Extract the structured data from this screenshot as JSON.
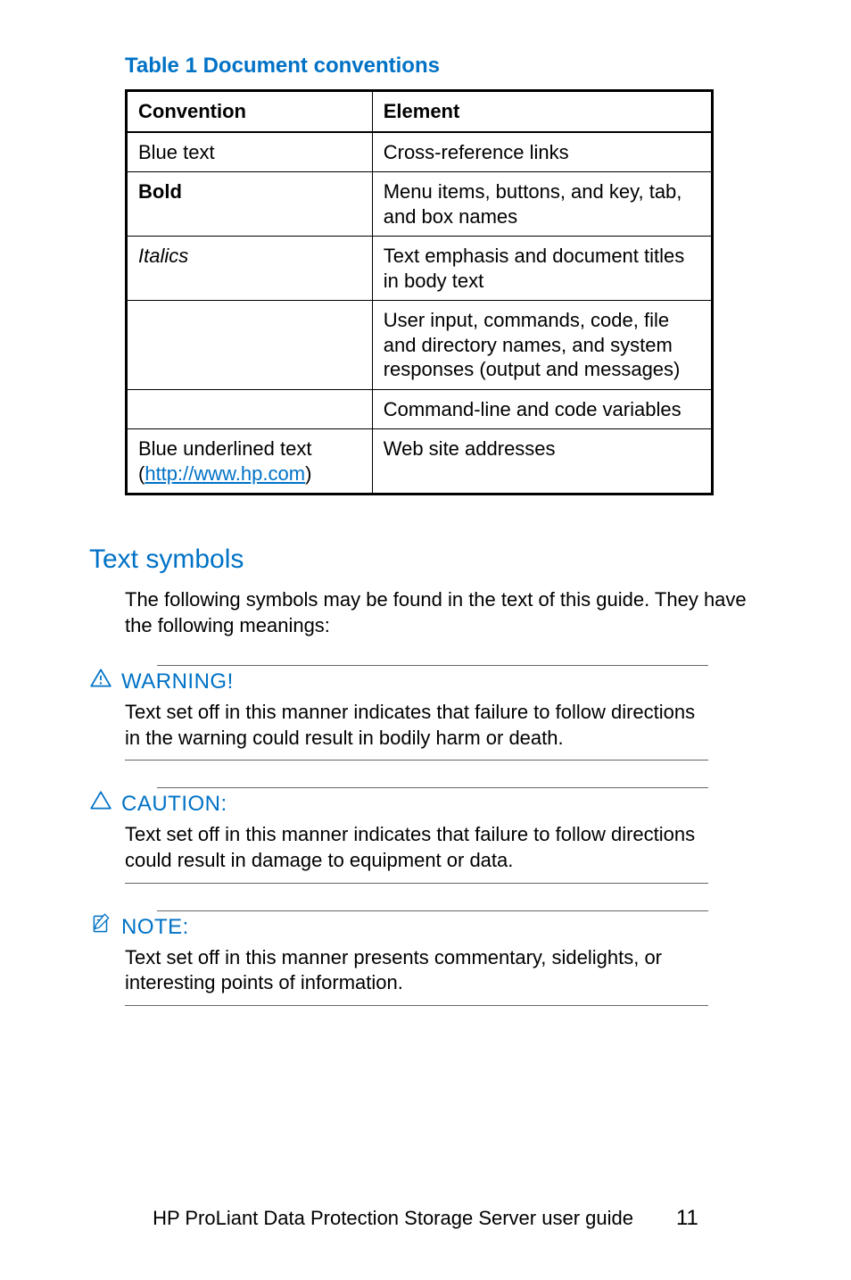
{
  "table": {
    "title": "Table 1 Document conventions",
    "headers": {
      "convention": "Convention",
      "element": "Element"
    },
    "rows": [
      {
        "convention": "Blue text",
        "convention_class": "",
        "element": "Cross-reference links"
      },
      {
        "convention": "Bold",
        "convention_class": "bold",
        "element": "Menu items, buttons, and key, tab, and box names"
      },
      {
        "convention": "Italics",
        "convention_class": "italic",
        "element": "Text emphasis and document titles in body text"
      },
      {
        "convention": "",
        "convention_class": "",
        "element": "User input, commands, code, file and directory names, and system responses (output and messages)"
      },
      {
        "convention": "",
        "convention_class": "",
        "element": "Command-line and code variables"
      }
    ],
    "link_row": {
      "prefix": "Blue underlined text (",
      "link": "http://www.hp.com",
      "suffix": ")",
      "element": "Web site addresses"
    }
  },
  "section": {
    "heading": "Text symbols",
    "intro": "The following symbols may be found in the text of this guide. They have the following meanings:"
  },
  "callouts": {
    "warning": {
      "title": "WARNING!",
      "body": "Text set off in this manner indicates that failure to follow directions in the warning could result in bodily harm or death."
    },
    "caution": {
      "title": "CAUTION:",
      "body": "Text set off in this manner indicates that failure to follow directions could result in damage to equipment or data."
    },
    "note": {
      "title": "NOTE:",
      "body": "Text set off in this manner presents commentary, sidelights, or interesting points of information."
    }
  },
  "footer": {
    "text": "HP ProLiant Data Protection Storage Server user guide",
    "page": "11"
  }
}
